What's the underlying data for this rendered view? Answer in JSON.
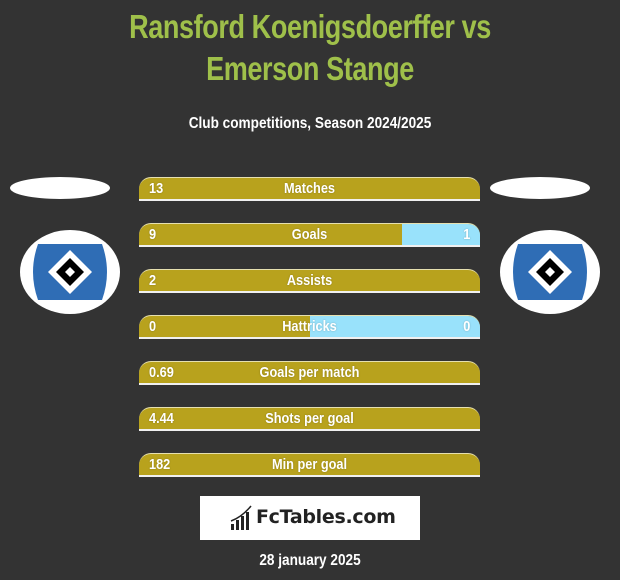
{
  "header": {
    "title": "Ransford Koenigsdoerffer vs Emerson Stange",
    "subtitle": "Club competitions, Season 2024/2025"
  },
  "players": {
    "left": {
      "name": "Ransford Koenigsdoerffer",
      "club_logo": "hamburger-sv-logo-icon"
    },
    "right": {
      "name": "Emerson Stange",
      "club_logo": "hamburger-sv-logo-icon"
    }
  },
  "colors": {
    "title": "#9fc04a",
    "left_bar": "#b8a21d",
    "right_bar": "#99e2fb",
    "background": "#333333"
  },
  "stats": [
    {
      "label": "Matches",
      "left": "13",
      "right": "",
      "right_share": 0
    },
    {
      "label": "Goals",
      "left": "9",
      "right": "1",
      "right_share": 0.23
    },
    {
      "label": "Assists",
      "left": "2",
      "right": "",
      "right_share": 0
    },
    {
      "label": "Hattricks",
      "left": "0",
      "right": "0",
      "right_share": 0.5
    },
    {
      "label": "Goals per match",
      "left": "0.69",
      "right": "",
      "right_share": 0
    },
    {
      "label": "Shots per goal",
      "left": "4.44",
      "right": "",
      "right_share": 0
    },
    {
      "label": "Min per goal",
      "left": "182",
      "right": "",
      "right_share": 0
    }
  ],
  "brand": {
    "name": "FcTables.com",
    "icon": "bar-chart-icon"
  },
  "footer": {
    "date": "28 january 2025"
  }
}
